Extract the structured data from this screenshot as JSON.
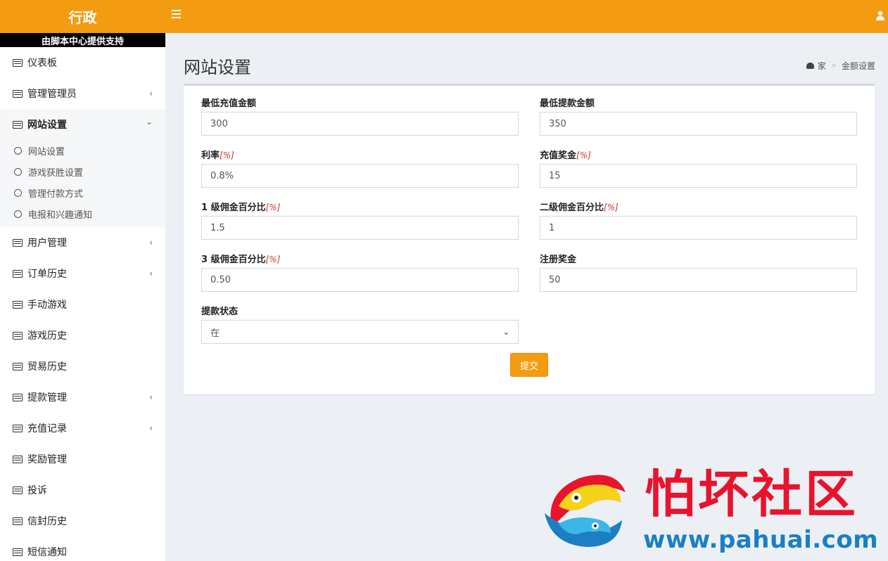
{
  "header": {
    "logo": "行政",
    "menu_icon": "hamburger-icon",
    "user_icon": "user-icon",
    "accent_color": "#f39c12"
  },
  "sidebar": {
    "banner": "由脚本中心提供支持",
    "items": [
      {
        "label": "仪表板",
        "chevron": ""
      },
      {
        "label": "管理管理员",
        "chevron": "‹"
      },
      {
        "label": "网站设置",
        "chevron": "⌄"
      },
      {
        "label": "用户管理",
        "chevron": "‹"
      },
      {
        "label": "订单历史",
        "chevron": "‹"
      },
      {
        "label": "手动游戏",
        "chevron": ""
      },
      {
        "label": "游戏历史",
        "chevron": ""
      },
      {
        "label": "贸易历史",
        "chevron": ""
      },
      {
        "label": "提款管理",
        "chevron": "‹"
      },
      {
        "label": "充值记录",
        "chevron": "‹"
      },
      {
        "label": "奖励管理",
        "chevron": ""
      },
      {
        "label": "投诉",
        "chevron": ""
      },
      {
        "label": "信封历史",
        "chevron": ""
      },
      {
        "label": "短信通知",
        "chevron": ""
      }
    ],
    "submenu": [
      {
        "label": "网站设置"
      },
      {
        "label": "游戏获胜设置"
      },
      {
        "label": "管理付款方式"
      },
      {
        "label": "电报和兴趣通知"
      }
    ]
  },
  "page": {
    "title": "网站设置",
    "breadcrumb": {
      "home": "家",
      "current": "金额设置",
      "separator": "»"
    }
  },
  "form": {
    "min_recharge": {
      "label": "最低充值金额",
      "value": "300"
    },
    "min_withdraw": {
      "label": "最低提款金额",
      "value": "350"
    },
    "rate": {
      "label": "利率",
      "unit": "[%]",
      "value": "0.8%"
    },
    "recharge_bonus": {
      "label": "充值奖金",
      "unit": "[%]",
      "value": "15"
    },
    "level1": {
      "label": "1 级佣金百分比",
      "unit": "[%]",
      "value": "1.5"
    },
    "level2": {
      "label": "二级佣金百分比",
      "unit": "[%]",
      "value": "1"
    },
    "level3": {
      "label": "3 级佣金百分比",
      "unit": "[%]",
      "value": "0.50"
    },
    "register_bonus": {
      "label": "注册奖金",
      "value": "50"
    },
    "withdraw_status": {
      "label": "提款状态",
      "value": "在"
    },
    "submit_label": "提交"
  },
  "watermark": {
    "text": "怕坏社区",
    "url": "www.pahuai.com",
    "logo_icon": "fish-logo-icon"
  }
}
